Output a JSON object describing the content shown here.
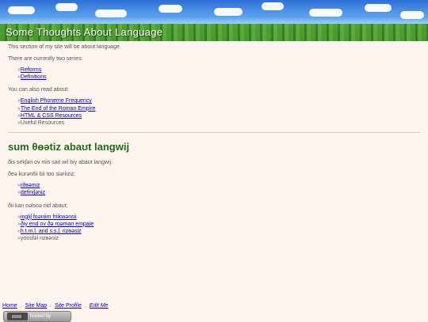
{
  "banner": {
    "title": "Some Thoughts About Language"
  },
  "english": {
    "intro": "This section of my site will be about language.",
    "series_intro": "There are currently two series:",
    "series": [
      {
        "label": "Reforms",
        "link": true
      },
      {
        "label": "Definitions",
        "link": true
      }
    ],
    "also_intro": "You can also read about:",
    "also": [
      {
        "label": "English Phoneme Frequency",
        "link": true
      },
      {
        "label": "The End of the Roman Empire",
        "link": true
      },
      {
        "label": "HTML & CSS Resources",
        "link": true
      },
      {
        "label": "Useful Resources",
        "link": false
      }
    ]
  },
  "phonetic": {
    "heading": "sum θɵətiz abaʊt langwij",
    "intro": "ðis sekʃən ov mis sait wil biy abaʊt langwij.",
    "series_intro": "ðeə kurəntlii bii tɒo siəriiziz:",
    "series": [
      {
        "label": "rifɵəmiz",
        "link": true
      },
      {
        "label": "definiʃəniz",
        "link": true
      }
    ],
    "also_intro": "ðii kan oəlsoə riid abaʊt:",
    "also": [
      {
        "label": "ingliʃ foəniim friikwənsii",
        "link": true
      },
      {
        "label": "ðiy end ov ðə roəman empaie",
        "link": true
      },
      {
        "label": "h.t.m.l. and s.s.ʃ. rizɵəsiz",
        "link": true
      },
      {
        "label": "yoosfəl rizɵəsiz",
        "link": false
      }
    ]
  },
  "bullet": "»",
  "footer": {
    "links": [
      "Home",
      "Site Map",
      "Site Profile",
      "Edit Me"
    ],
    "separator": "...",
    "badge_text": "hosted by"
  },
  "colors": {
    "background": "#fff5ee",
    "heading": "#1a6b1a",
    "link": "#0000cc"
  }
}
